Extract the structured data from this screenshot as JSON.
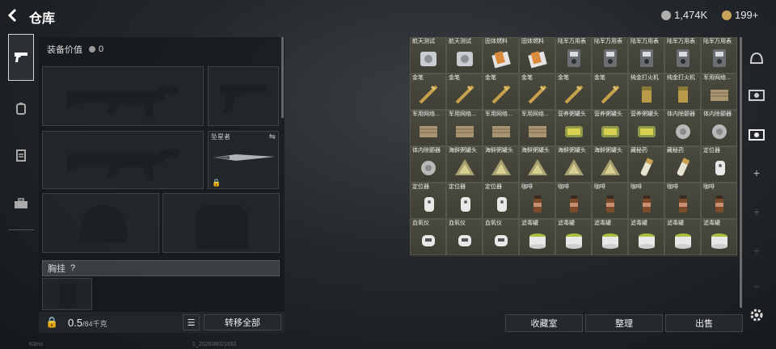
{
  "header": {
    "title": "仓库",
    "back_icon": "back-arrow-icon"
  },
  "currency": [
    {
      "value": "1,474K",
      "icon": "silver-coin-icon",
      "color": "#b0b0b0"
    },
    {
      "value": "199+",
      "icon": "gold-coin-icon",
      "color": "#c9a25a"
    }
  ],
  "left_tabs": [
    {
      "icon": "pistol-icon"
    },
    {
      "icon": "backpack-icon"
    },
    {
      "icon": "clipboard-icon"
    },
    {
      "icon": "toolbox-icon"
    }
  ],
  "equipment": {
    "value_label": "装备价值",
    "value": "0",
    "knife_slot_label": "坠星者",
    "weight": "0.5",
    "weight_unit": "/84千克",
    "chest_rig_label": "胸挂",
    "chest_rig_help": "?",
    "transfer_all": "转移全部"
  },
  "items": [
    {
      "name": "航天测试",
      "icon": "test-device-icon"
    },
    {
      "name": "航天测试",
      "icon": "test-device-icon"
    },
    {
      "name": "固体燃料",
      "icon": "solid-fuel-icon"
    },
    {
      "name": "固体燃料",
      "icon": "solid-fuel-icon"
    },
    {
      "name": "陆军万用表",
      "icon": "multimeter-icon"
    },
    {
      "name": "陆军万用表",
      "icon": "multimeter-icon"
    },
    {
      "name": "陆军万用表",
      "icon": "multimeter-icon"
    },
    {
      "name": "陆军万用表",
      "icon": "multimeter-icon"
    },
    {
      "name": "陆军万用表",
      "icon": "multimeter-icon"
    },
    {
      "name": "金笔",
      "icon": "gold-pen-icon"
    },
    {
      "name": "金笔",
      "icon": "gold-pen-icon"
    },
    {
      "name": "金笔",
      "icon": "gold-pen-icon"
    },
    {
      "name": "金笔",
      "icon": "gold-pen-icon"
    },
    {
      "name": "金笔",
      "icon": "gold-pen-icon"
    },
    {
      "name": "金笔",
      "icon": "gold-pen-icon"
    },
    {
      "name": "纯金打火机",
      "icon": "gold-lighter-icon"
    },
    {
      "name": "纯金打火机",
      "icon": "gold-lighter-icon"
    },
    {
      "name": "军用网络...",
      "icon": "network-box-icon"
    },
    {
      "name": "军用网络...",
      "icon": "network-box-icon"
    },
    {
      "name": "军用网络...",
      "icon": "network-box-icon"
    },
    {
      "name": "军用网络...",
      "icon": "network-box-icon"
    },
    {
      "name": "军用网络...",
      "icon": "network-box-icon"
    },
    {
      "name": "营养粥罐头",
      "icon": "porridge-can-icon"
    },
    {
      "name": "营养粥罐头",
      "icon": "porridge-can-icon"
    },
    {
      "name": "营养粥罐头",
      "icon": "porridge-can-icon"
    },
    {
      "name": "体内除颤器",
      "icon": "defibrillator-icon"
    },
    {
      "name": "体内除颤器",
      "icon": "defibrillator-icon"
    },
    {
      "name": "体内除颤器",
      "icon": "defibrillator-icon"
    },
    {
      "name": "海鲜粥罐头",
      "icon": "seafood-can-icon"
    },
    {
      "name": "海鲜粥罐头",
      "icon": "seafood-can-icon"
    },
    {
      "name": "海鲜粥罐头",
      "icon": "seafood-can-icon"
    },
    {
      "name": "海鲜粥罐头",
      "icon": "seafood-can-icon"
    },
    {
      "name": "海鲜粥罐头",
      "icon": "seafood-can-icon"
    },
    {
      "name": "藏秘药",
      "icon": "medicine-icon"
    },
    {
      "name": "藏秘药",
      "icon": "medicine-icon"
    },
    {
      "name": "定位器",
      "icon": "locator-icon"
    },
    {
      "name": "定位器",
      "icon": "locator-icon"
    },
    {
      "name": "定位器",
      "icon": "locator-icon"
    },
    {
      "name": "定位器",
      "icon": "locator-icon"
    },
    {
      "name": "咖啡",
      "icon": "coffee-icon"
    },
    {
      "name": "咖啡",
      "icon": "coffee-icon"
    },
    {
      "name": "咖啡",
      "icon": "coffee-icon"
    },
    {
      "name": "咖啡",
      "icon": "coffee-icon"
    },
    {
      "name": "咖啡",
      "icon": "coffee-icon"
    },
    {
      "name": "咖啡",
      "icon": "coffee-icon"
    },
    {
      "name": "血氧仪",
      "icon": "oximeter-icon"
    },
    {
      "name": "血氧仪",
      "icon": "oximeter-icon"
    },
    {
      "name": "血氧仪",
      "icon": "oximeter-icon"
    },
    {
      "name": "滤毒罐",
      "icon": "filter-can-icon"
    },
    {
      "name": "滤毒罐",
      "icon": "filter-can-icon"
    },
    {
      "name": "滤毒罐",
      "icon": "filter-can-icon"
    },
    {
      "name": "滤毒罐",
      "icon": "filter-can-icon"
    },
    {
      "name": "滤毒罐",
      "icon": "filter-can-icon"
    },
    {
      "name": "滤毒罐",
      "icon": "filter-can-icon"
    }
  ],
  "bottom": {
    "collection": "收藏室",
    "sort": "整理",
    "sell": "出售"
  },
  "right_tabs": [
    {
      "icon": "helmet-tab-icon"
    },
    {
      "icon": "card-tab-icon"
    },
    {
      "icon": "tv-tab-icon"
    },
    {
      "label": "+"
    },
    {
      "label": "+"
    },
    {
      "label": "+"
    },
    {
      "label": "+"
    },
    {
      "label": "+"
    }
  ],
  "status": {
    "ping": "63ms",
    "build": "1_202606021652"
  }
}
